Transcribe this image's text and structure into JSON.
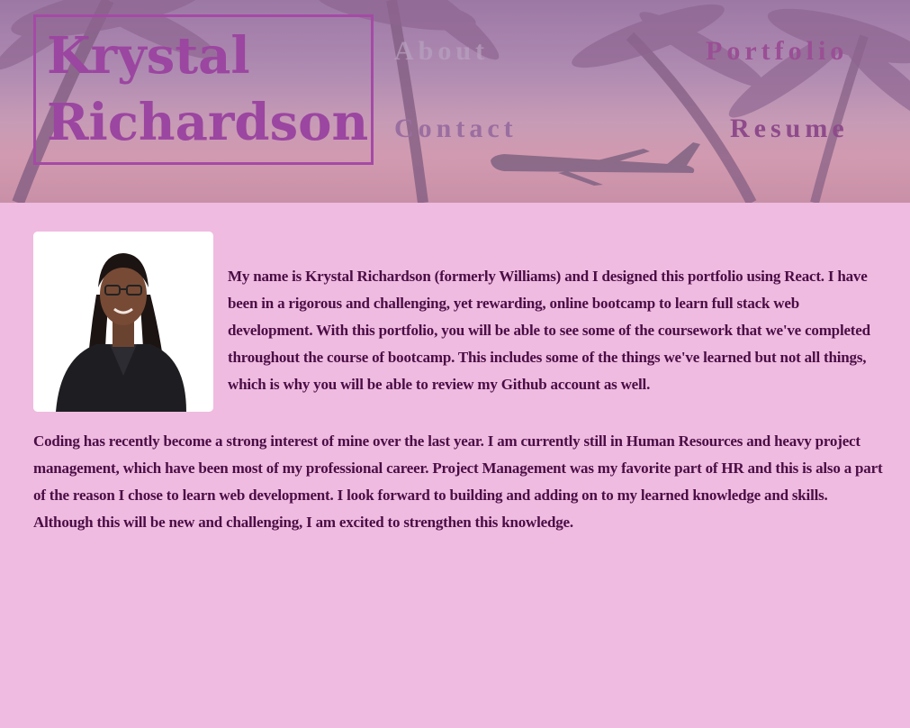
{
  "header": {
    "name": "Krystal Richardson",
    "nav": {
      "about": "About",
      "portfolio": "Portfolio",
      "contact": "Contact",
      "resume": "Resume"
    }
  },
  "main": {
    "photo_alt": "Krystal Richardson",
    "paragraph_1": "My name is Krystal Richardson (formerly Williams) and I designed this portfolio using React. I have been in a rigorous and challenging, yet rewarding, online bootcamp to learn full stack web development. With this portfolio, you will be able to see some of the coursework that we've completed throughout the course of bootcamp. This includes some of the things we've learned but not all things, which is why you will be able to review my Github account as well.",
    "paragraph_2": "Coding has recently become a strong interest of mine over the last year. I am currently still in Human Resources and heavy project management, which have been most of my professional career. Project Management was my favorite part of HR and this is also a part of the reason I chose to learn web development. I look forward to building and adding on to my learned knowledge and skills. Although this will be new and challenging, I am excited to strengthen this knowledge."
  },
  "colors": {
    "page_background": "#efbbe0",
    "name_color": "#9b46a0",
    "text_color": "#4a0d45"
  },
  "icons": {
    "header_image": "palm-trees-airplane-sunset"
  }
}
